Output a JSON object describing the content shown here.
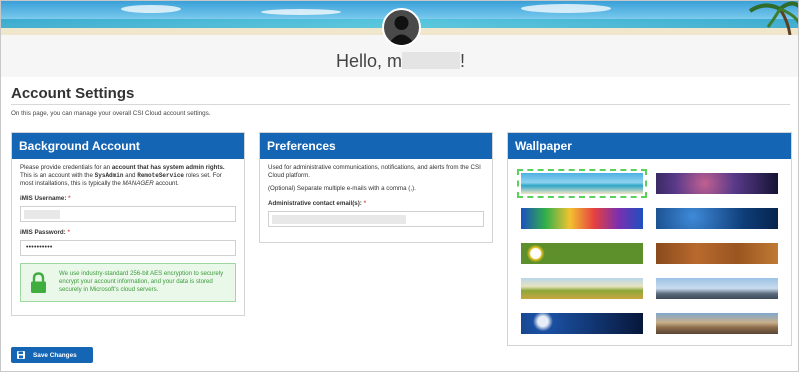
{
  "greeting": {
    "prefix": "Hello, m",
    "suffix": "!"
  },
  "page": {
    "title": "Account Settings",
    "description": "On this page, you can manage your overall CSI Cloud account settings."
  },
  "background_account": {
    "heading": "Background Account",
    "intro_1": "Please provide credentials for an ",
    "intro_bold": "account that has system admin rights.",
    "intro_2": " This is an account with the ",
    "role_1": "SysAdmin",
    "intro_3": " and ",
    "role_2": "RemoteService",
    "intro_4": " roles set. For most installations, this is typically the ",
    "manager": "MANAGER",
    "intro_5": " account.",
    "username_label": "iMIS Username:",
    "password_label": "iMIS Password:",
    "password_value": "••••••••••",
    "required_mark": "*",
    "security_notice": "We use industry-standard 256-bit AES encryption to securely encrypt your account information, and your data is stored securely in Microsoft's cloud servers."
  },
  "preferences": {
    "heading": "Preferences",
    "intro": "Used for administrative communications, notifications, and alerts from the CSI Cloud platform.",
    "optional_note": "(Optional) Separate multiple e-mails with a comma (,).",
    "email_label": "Administrative contact email(s):",
    "required_mark": "*"
  },
  "wallpaper": {
    "heading": "Wallpaper",
    "options": [
      {
        "name": "beach-palm",
        "selected": true
      },
      {
        "name": "galaxy-purple",
        "selected": false
      },
      {
        "name": "color-splash",
        "selected": false
      },
      {
        "name": "blue-sparkle",
        "selected": false
      },
      {
        "name": "daisies",
        "selected": false
      },
      {
        "name": "rust-texture",
        "selected": false
      },
      {
        "name": "wheat-field",
        "selected": false
      },
      {
        "name": "city-skyline",
        "selected": false
      },
      {
        "name": "planet-space",
        "selected": false
      },
      {
        "name": "desert-mountains",
        "selected": false
      }
    ]
  },
  "actions": {
    "save_label": "Save Changes"
  },
  "colors": {
    "accent": "#1565b5",
    "success": "#3c9a3c",
    "required": "#d9534f"
  }
}
